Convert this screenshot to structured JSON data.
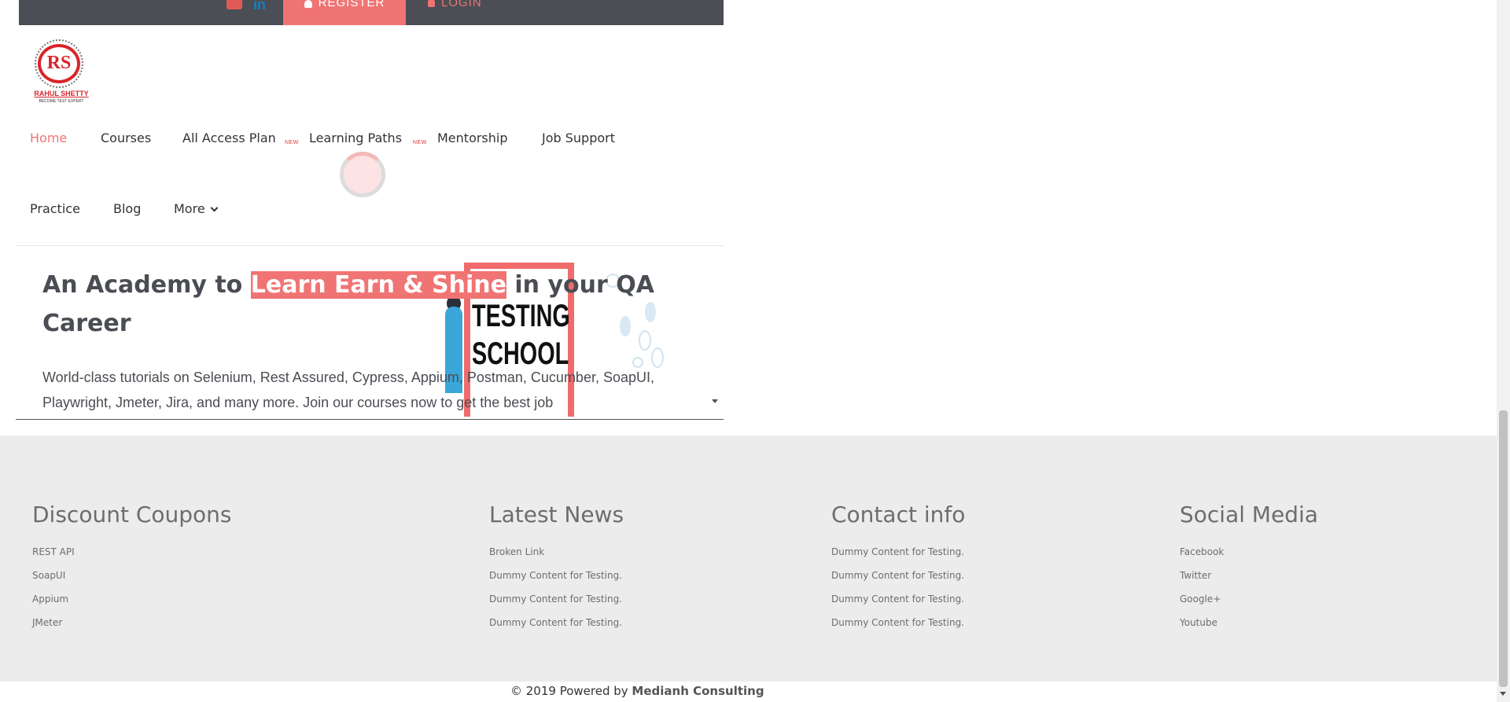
{
  "topbar": {
    "youtube_icon": "youtube-icon",
    "linkedin_icon": "linkedin-icon",
    "linkedin_text": "in",
    "register_label": "REGISTER",
    "login_label": "LOGIN",
    "accent_color": "#f07474"
  },
  "logo": {
    "mark": "RS",
    "name": "RAHUL SHETTY",
    "tagline": "BECOME TEST EXPERT"
  },
  "nav": {
    "items": [
      {
        "label": "Home",
        "active": true
      },
      {
        "label": "Courses"
      },
      {
        "label": "All Access Plan",
        "badge": "NEW"
      },
      {
        "label": "Learning Paths",
        "badge": "NEW"
      },
      {
        "label": "Mentorship"
      },
      {
        "label": "Job Support"
      },
      {
        "label": "Practice"
      },
      {
        "label": "Blog"
      },
      {
        "label": "More"
      }
    ]
  },
  "hero": {
    "title_prefix": "An Academy to ",
    "title_highlight": "Learn Earn & Shine",
    "title_suffix": "  in your QA Career",
    "description": "World-class tutorials on Selenium, Rest Assured, Cypress, Appium, Postman, Cucumber, SoapUI, Playwright, Jmeter, Jira, and many more. Join our courses now to get the best job",
    "board_text_1": "TESTING",
    "board_text_2": "SCHOOL"
  },
  "footer": {
    "columns": [
      {
        "heading": "Discount Coupons",
        "items": [
          "REST API",
          "SoapUI",
          "Appium",
          "JMeter"
        ]
      },
      {
        "heading": "Latest News",
        "items": [
          "Broken Link",
          "Dummy Content for Testing.",
          "Dummy Content for Testing.",
          "Dummy Content for Testing."
        ]
      },
      {
        "heading": "Contact info",
        "items": [
          "Dummy Content for Testing.",
          "Dummy Content for Testing.",
          "Dummy Content for Testing.",
          "Dummy Content for Testing."
        ]
      },
      {
        "heading": "Social Media",
        "items": [
          "Facebook",
          "Twitter",
          "Google+",
          "Youtube"
        ]
      }
    ],
    "copyright_text": "© 2019 Powered by ",
    "copyright_brand": "Medianh Consulting"
  }
}
